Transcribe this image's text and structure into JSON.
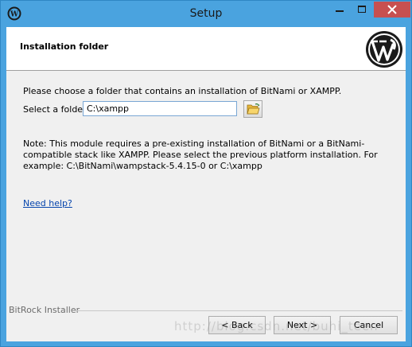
{
  "window": {
    "title": "Setup"
  },
  "header": {
    "title": "Installation folder",
    "logo_icon": "wordpress-logo"
  },
  "main": {
    "intro": "Please choose a folder that contains an installation of BitNami or XAMPP.",
    "folder_label": "Select a folder",
    "folder_value": "C:\\xampp",
    "browse_icon": "folder-open-icon",
    "note": "Note: This module requires a pre-existing installation of BitNami or a BitNami-compatible stack like XAMPP. Please select the previous platform installation. For example: C:\\BitNami\\wampstack-5.4.15-0 or C:\\xampp",
    "help_link": "Need help?"
  },
  "footer": {
    "installer_label": "BitRock Installer",
    "back_label": "< Back",
    "next_label": "Next >",
    "cancel_label": "Cancel"
  },
  "watermark": "http://blog.csdn.net/buhi_teen",
  "colors": {
    "titlebar": "#4aa3df",
    "close_button": "#c75050",
    "dialog_bg": "#f0f0f0",
    "link": "#0645ad"
  }
}
